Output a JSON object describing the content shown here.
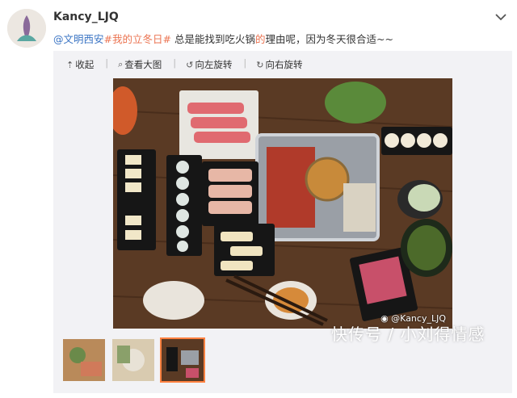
{
  "user": {
    "name": "Kancy_LJQ"
  },
  "post": {
    "mention": "@文明西安",
    "topic": "#我的立冬日#",
    "text_a": " 总是能找到吃火锅",
    "text_b": "的",
    "text_c": "理由呢，因为冬天很合适~~"
  },
  "toolbar": [
    {
      "label": "收起",
      "icon": "arrow-up-icon"
    },
    {
      "label": "查看大图",
      "icon": "search-icon"
    },
    {
      "label": "向左旋转",
      "icon": "rotate-left-icon"
    },
    {
      "label": "向右旋转",
      "icon": "rotate-right-icon"
    }
  ],
  "photo": {
    "watermark": "@Kancy_LJQ"
  },
  "thumbnails": [
    {
      "active": false
    },
    {
      "active": false
    },
    {
      "active": true
    }
  ],
  "site_watermark": "快传号 / 小刘得情感",
  "colors": {
    "link": "#eb7350",
    "mention": "#3a74c4",
    "active_thumb": "#ff8140"
  }
}
